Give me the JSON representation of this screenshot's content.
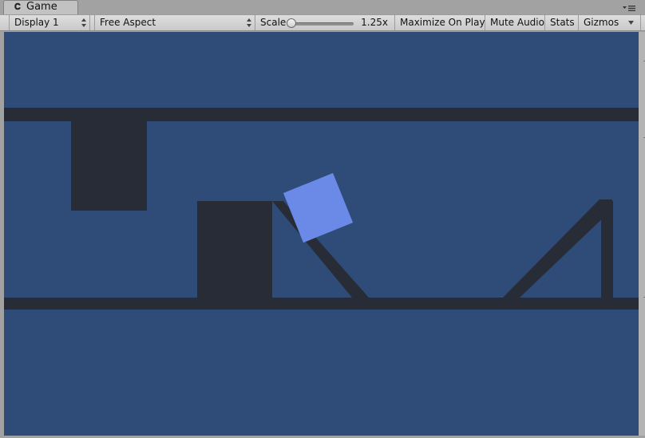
{
  "window": {
    "tab_title": "Game",
    "tab_icon": "unity-logo-icon"
  },
  "toolbar": {
    "display": "Display 1",
    "aspect": "Free Aspect",
    "scale_label": "Scale",
    "scale_value": "1.25x",
    "scale_slider_fraction": 0.03,
    "maximize_on_play": "Maximize On Play",
    "mute_audio": "Mute Audio",
    "stats": "Stats",
    "gizmos": "Gizmos"
  },
  "scene": {
    "background_color": "#2f4b78",
    "wall_color": "#272c36",
    "player_color": "#6b8ae8"
  }
}
